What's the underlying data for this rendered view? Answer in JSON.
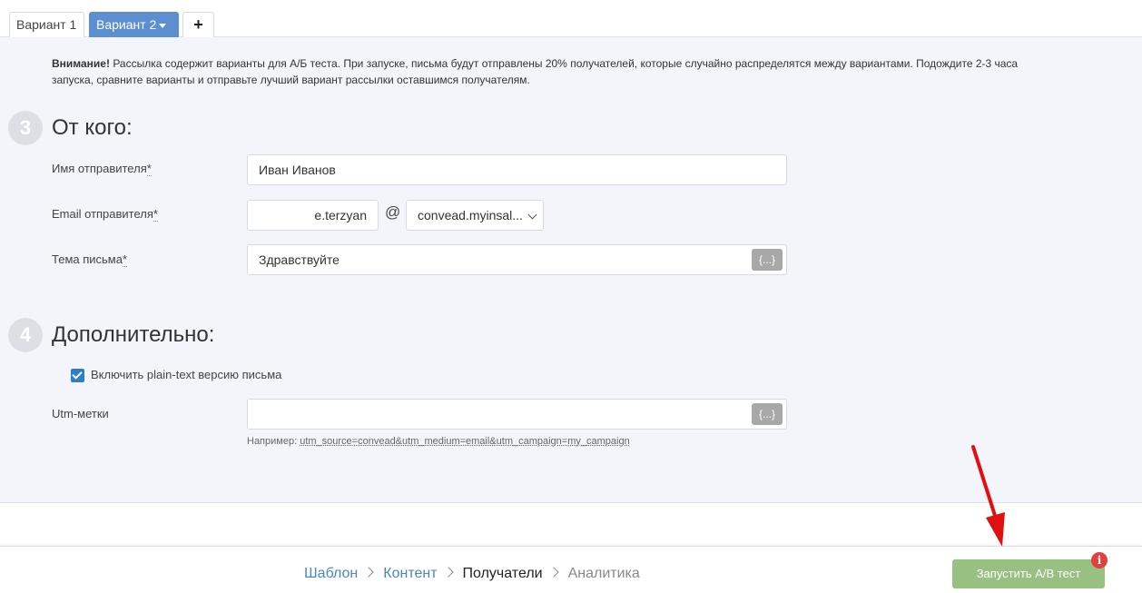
{
  "tabs": {
    "variant1": "Вариант 1",
    "variant2": "Вариант 2",
    "add": "+"
  },
  "notice": {
    "bold": "Внимание!",
    "line1": " Рассылка содержит варианты для А/Б теста. При запуске, письма будут отправлены 20% получателей, которые случайно распределятся между вариантами. Подождите 2-3 часа",
    "line2": "запуска, сравните варианты и отправьте лучший вариант рассылки оставшимся получателям."
  },
  "section_from": {
    "number": "3",
    "title": "От кого:",
    "sender_name_label": "Имя отправителя",
    "sender_name_value": "Иван Иванов",
    "sender_email_label": "Email отправителя",
    "email_local": "e.terzyan",
    "at_sign": "@",
    "email_domain": "convead.myinsal...",
    "subject_label": "Тема письма",
    "subject_value": "Здравствуйте",
    "var_btn": "{...}",
    "required_mark": "*"
  },
  "section_extra": {
    "number": "4",
    "title": "Дополнительно:",
    "plain_text_label": "Включить plain-text версию письма",
    "plain_text_checked": true,
    "utm_label": "Utm-метки",
    "utm_value": "",
    "var_btn": "{...}",
    "hint_prefix": "Например: ",
    "hint_example": "utm_source=convead&utm_medium=email&utm_campaign=my_campaign"
  },
  "footer": {
    "crumbs": [
      "Шаблон",
      "Контент",
      "Получатели",
      "Аналитика"
    ],
    "launch_button": "Запустить A/B тест",
    "info_badge": "i"
  },
  "colors": {
    "accent": "#5b8fd0",
    "launch": "#98c083",
    "badge": "#e04040",
    "arrow": "#e01010"
  }
}
